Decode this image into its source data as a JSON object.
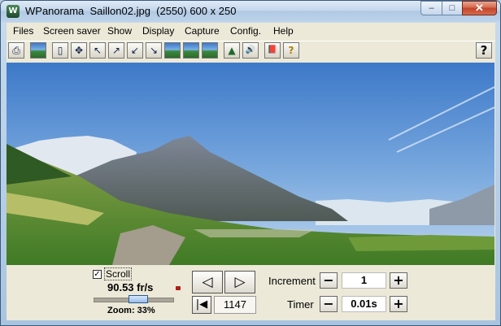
{
  "window": {
    "title": "WPanorama  Saillon02.jpg  (2550) 600 x 250",
    "app_icon_glyph": "W",
    "minimize_glyph": "–",
    "maximize_glyph": "□",
    "close_glyph": "✕"
  },
  "menu": [
    "Files",
    "Screen saver",
    "Show",
    "Display",
    "Capture",
    "Config.",
    "Help"
  ],
  "toolbar": {
    "buttons": [
      {
        "icon": "print-icon",
        "glyph": "⎙"
      },
      {
        "icon": "open-picture-icon",
        "glyph": ""
      },
      {
        "icon": "page-icon",
        "glyph": "▯"
      },
      {
        "icon": "move-arrows-icon",
        "glyph": "✥"
      },
      {
        "icon": "arrow-up-left-icon",
        "glyph": "↖"
      },
      {
        "icon": "arrow-up-right-icon",
        "glyph": "↗"
      },
      {
        "icon": "arrow-down-left-icon",
        "glyph": "↙"
      },
      {
        "icon": "arrow-down-right-icon",
        "glyph": "↘"
      },
      {
        "icon": "picture-view-1-icon",
        "glyph": ""
      },
      {
        "icon": "picture-view-2-icon",
        "glyph": ""
      },
      {
        "icon": "picture-view-3-icon",
        "glyph": ""
      },
      {
        "icon": "pyramid-icon",
        "glyph": "▲"
      },
      {
        "icon": "sound-icon",
        "glyph": "🔊"
      },
      {
        "icon": "book-icon",
        "glyph": "📕"
      },
      {
        "icon": "help-context-icon",
        "glyph": "?"
      }
    ],
    "help_glyph": "?"
  },
  "controls": {
    "scroll_checked": true,
    "scroll_check_glyph": "✓",
    "scroll_label": "Scroll",
    "fps": "90.53 fr/s",
    "zoom": "Zoom: 33%",
    "zoom_level": 0.33,
    "prev_glyph": "◁",
    "next_glyph": "▷",
    "first_glyph": "|◀",
    "counter": "1147",
    "increment_label": "Increment",
    "increment_value": "1",
    "timer_label": "Timer",
    "timer_value": "0.01s",
    "minus_glyph": "−",
    "plus_glyph": "+"
  },
  "colors": {
    "sky_top": "#3d79c9",
    "sky_bottom": "#bfd7ef",
    "mountain": "#6d7a8b",
    "vineyard": "#4f8a2e"
  }
}
